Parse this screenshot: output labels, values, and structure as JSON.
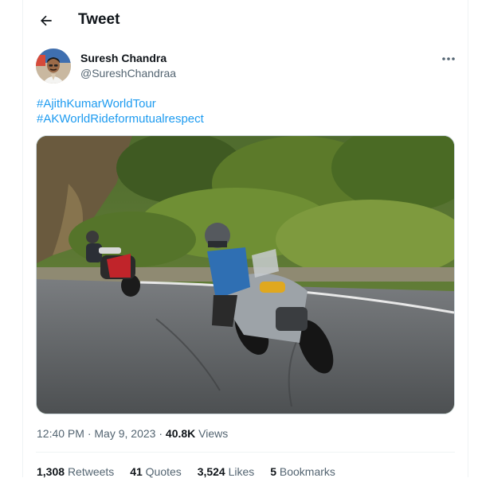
{
  "header": {
    "title": "Tweet",
    "back_icon": "arrow-left-icon"
  },
  "author": {
    "name": "Suresh Chandra",
    "handle": "@SureshChandraa"
  },
  "tweet": {
    "hashtags": [
      "#AjithKumarWorldTour",
      "#AKWorldRideformutualrespect"
    ],
    "time": "12:40 PM",
    "separator": "·",
    "date": "May 9, 2023",
    "views_count": "40.8K",
    "views_label": "Views"
  },
  "stats": {
    "retweets_count": "1,308",
    "retweets_label": "Retweets",
    "quotes_count": "41",
    "quotes_label": "Quotes",
    "likes_count": "3,524",
    "likes_label": "Likes",
    "bookmarks_count": "5",
    "bookmarks_label": "Bookmarks"
  },
  "colors": {
    "link": "#1d9bf0",
    "text_primary": "#0f1419",
    "text_secondary": "#536471",
    "border": "#eff3f4"
  }
}
